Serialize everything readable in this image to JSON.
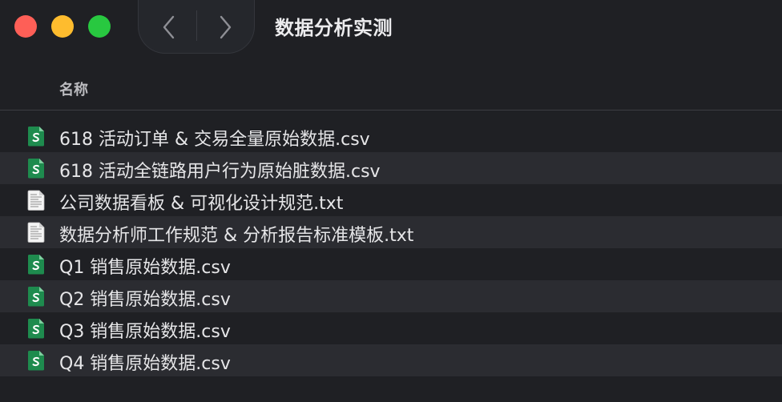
{
  "window": {
    "title": "数据分析实测"
  },
  "column_header": {
    "name_label": "名称"
  },
  "files": [
    {
      "name": "618 活动订单 & 交易全量原始数据.csv",
      "icon": "spreadsheet-icon"
    },
    {
      "name": "618 活动全链路用户行为原始脏数据.csv",
      "icon": "spreadsheet-icon"
    },
    {
      "name": "公司数据看板 & 可视化设计规范.txt",
      "icon": "text-document-icon"
    },
    {
      "name": "数据分析师工作规范 & 分析报告标准模板.txt",
      "icon": "text-document-icon"
    },
    {
      "name": "Q1 销售原始数据.csv",
      "icon": "spreadsheet-icon"
    },
    {
      "name": "Q2 销售原始数据.csv",
      "icon": "spreadsheet-icon"
    },
    {
      "name": "Q3 销售原始数据.csv",
      "icon": "spreadsheet-icon"
    },
    {
      "name": "Q4 销售原始数据.csv",
      "icon": "spreadsheet-icon"
    }
  ],
  "colors": {
    "background": "#1f2024",
    "row_alt": "#2b2c31",
    "close": "#fe5f57",
    "minimize": "#febc2e",
    "maximize": "#28c840",
    "sheet_green": "#1e8b4e"
  }
}
